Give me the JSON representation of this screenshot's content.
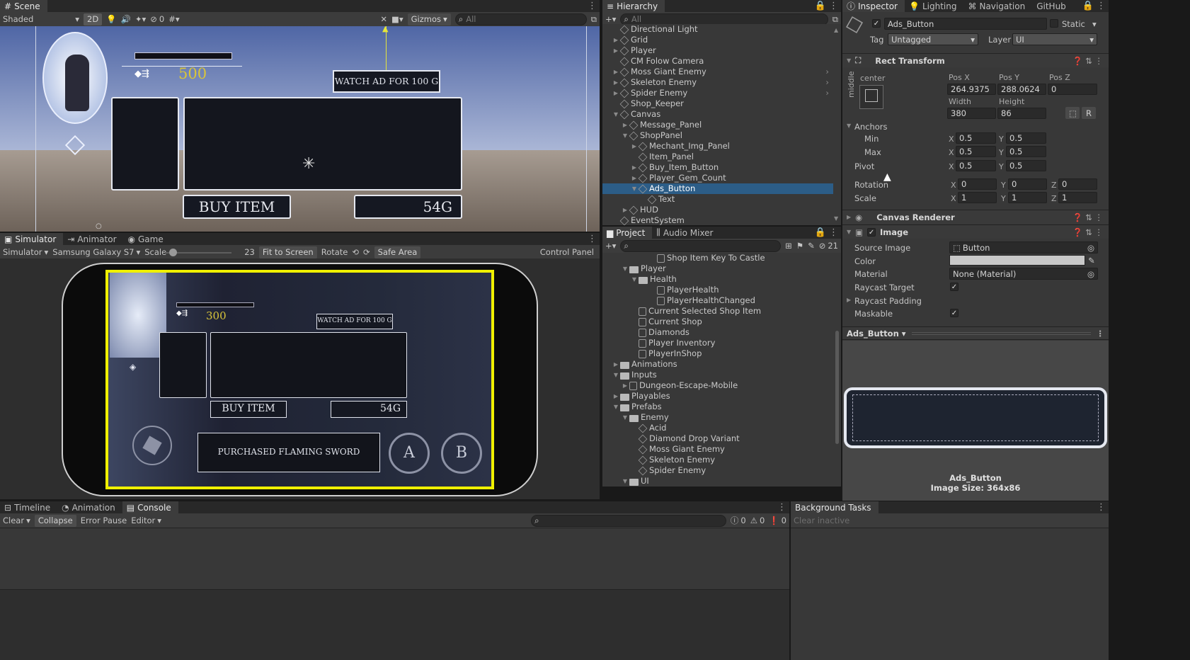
{
  "scene": {
    "tab": "Scene",
    "shading": "Shaded",
    "mode_2d": "2D",
    "gizmo_count": "0",
    "gizmos": "Gizmos",
    "search_placeholder": "All",
    "gem_count": "500",
    "watch_ad": "WATCH AD FOR 100 G",
    "buy_item": "BUY ITEM",
    "price": "54G"
  },
  "simulator": {
    "tabs": [
      "Simulator",
      "Animator",
      "Game"
    ],
    "view": "Simulator",
    "device": "Samsung Galaxy S7",
    "scale_label": "Scale",
    "scale_value": "23",
    "scale_fraction": 0.12,
    "fit": "Fit to Screen",
    "rotate": "Rotate",
    "safe_area": "Safe Area",
    "control_panel": "Control Panel",
    "game": {
      "gem_count": "300",
      "watch_ad": "WATCH AD FOR 100 G",
      "buy_item": "BUY ITEM",
      "price": "54G",
      "message": "PURCHASED FLAMING SWORD",
      "btn_a": "A",
      "btn_b": "B"
    }
  },
  "hierarchy": {
    "tab": "Hierarchy",
    "search_placeholder": "All",
    "items": [
      {
        "label": "Directional Light",
        "depth": 1,
        "arrow": "",
        "more": false
      },
      {
        "label": "Grid",
        "depth": 1,
        "arrow": "▶",
        "more": false
      },
      {
        "label": "Player",
        "depth": 1,
        "arrow": "▶",
        "more": false
      },
      {
        "label": "CM Folow Camera",
        "depth": 1,
        "arrow": "",
        "more": false
      },
      {
        "label": "Moss Giant Enemy",
        "depth": 1,
        "arrow": "▶",
        "more": true
      },
      {
        "label": "Skeleton Enemy",
        "depth": 1,
        "arrow": "▶",
        "more": true
      },
      {
        "label": "Spider Enemy",
        "depth": 1,
        "arrow": "▶",
        "more": true
      },
      {
        "label": "Shop_Keeper",
        "depth": 1,
        "arrow": "",
        "more": false
      },
      {
        "label": "Canvas",
        "depth": 1,
        "arrow": "▼",
        "more": false
      },
      {
        "label": "Message_Panel",
        "depth": 2,
        "arrow": "▶",
        "more": false
      },
      {
        "label": "ShopPanel",
        "depth": 2,
        "arrow": "▼",
        "more": false
      },
      {
        "label": "Mechant_Img_Panel",
        "depth": 3,
        "arrow": "▶",
        "more": false
      },
      {
        "label": "Item_Panel",
        "depth": 3,
        "arrow": "",
        "more": false
      },
      {
        "label": "Buy_Item_Button",
        "depth": 3,
        "arrow": "▶",
        "more": false
      },
      {
        "label": "Player_Gem_Count",
        "depth": 3,
        "arrow": "▶",
        "more": false
      },
      {
        "label": "Ads_Button",
        "depth": 3,
        "arrow": "▼",
        "more": false,
        "selected": true
      },
      {
        "label": "Text",
        "depth": 4,
        "arrow": "",
        "more": false
      },
      {
        "label": "HUD",
        "depth": 2,
        "arrow": "▶",
        "more": false
      },
      {
        "label": "EventSystem",
        "depth": 1,
        "arrow": "",
        "more": false
      }
    ]
  },
  "project": {
    "tabs": [
      "Project",
      "Audio Mixer"
    ],
    "hidden_count": "21",
    "items": [
      {
        "label": "Shop Item Key To Castle",
        "depth": 5,
        "icon": "file",
        "arrow": ""
      },
      {
        "label": "Player",
        "depth": 2,
        "icon": "folder",
        "arrow": "▼"
      },
      {
        "label": "Health",
        "depth": 3,
        "icon": "folder",
        "arrow": "▼"
      },
      {
        "label": "PlayerHealth",
        "depth": 5,
        "icon": "file",
        "arrow": ""
      },
      {
        "label": "PlayerHealthChanged",
        "depth": 5,
        "icon": "file",
        "arrow": ""
      },
      {
        "label": "Current Selected Shop Item",
        "depth": 3,
        "icon": "file",
        "arrow": ""
      },
      {
        "label": "Current Shop",
        "depth": 3,
        "icon": "file",
        "arrow": ""
      },
      {
        "label": "Diamonds",
        "depth": 3,
        "icon": "file",
        "arrow": ""
      },
      {
        "label": "Player Inventory",
        "depth": 3,
        "icon": "file",
        "arrow": ""
      },
      {
        "label": "PlayerInShop",
        "depth": 3,
        "icon": "file",
        "arrow": ""
      },
      {
        "label": "Animations",
        "depth": 1,
        "icon": "folder",
        "arrow": "▶"
      },
      {
        "label": "Inputs",
        "depth": 1,
        "icon": "folder",
        "arrow": "▼"
      },
      {
        "label": "Dungeon-Escape-Mobile",
        "depth": 2,
        "icon": "book",
        "arrow": "▶"
      },
      {
        "label": "Playables",
        "depth": 1,
        "icon": "folder",
        "arrow": "▶"
      },
      {
        "label": "Prefabs",
        "depth": 1,
        "icon": "folder",
        "arrow": "▼"
      },
      {
        "label": "Enemy",
        "depth": 2,
        "icon": "folder",
        "arrow": "▼"
      },
      {
        "label": "Acid",
        "depth": 3,
        "icon": "cube",
        "arrow": ""
      },
      {
        "label": "Diamond Drop Variant",
        "depth": 3,
        "icon": "cube",
        "arrow": ""
      },
      {
        "label": "Moss Giant Enemy",
        "depth": 3,
        "icon": "cube",
        "arrow": ""
      },
      {
        "label": "Skeleton Enemy",
        "depth": 3,
        "icon": "cube",
        "arrow": ""
      },
      {
        "label": "Spider Enemy",
        "depth": 3,
        "icon": "cube",
        "arrow": ""
      },
      {
        "label": "UI",
        "depth": 2,
        "icon": "folder",
        "arrow": "▼"
      }
    ]
  },
  "inspector": {
    "tabs": [
      "Inspector",
      "Lighting",
      "Navigation",
      "GitHub"
    ],
    "object_name": "Ads_Button",
    "static": "Static",
    "tag_label": "Tag",
    "tag": "Untagged",
    "layer_label": "Layer",
    "layer": "UI",
    "rect_transform": "Rect Transform",
    "anchor_h": "center",
    "anchor_v": "middle",
    "pos_x_label": "Pos X",
    "pos_x": "264.9375",
    "pos_y_label": "Pos Y",
    "pos_y": "288.0624",
    "pos_z_label": "Pos Z",
    "pos_z": "0",
    "width_label": "Width",
    "width": "380",
    "height_label": "Height",
    "height": "86",
    "r_button": "R",
    "anchors_label": "Anchors",
    "min_label": "Min",
    "min_x": "0.5",
    "min_y": "0.5",
    "max_label": "Max",
    "max_x": "0.5",
    "max_y": "0.5",
    "pivot_label": "Pivot",
    "pivot_x": "0.5",
    "pivot_y": "0.5",
    "rotation_label": "Rotation",
    "rot_x": "0",
    "rot_y": "0",
    "rot_z": "0",
    "scale_label": "Scale",
    "scale_x": "1",
    "scale_y": "1",
    "scale_z": "1",
    "x": "X",
    "y": "Y",
    "z": "Z",
    "canvas_renderer": "Canvas Renderer",
    "image": "Image",
    "source_image_label": "Source Image",
    "source_image": "Button",
    "color_label": "Color",
    "material_label": "Material",
    "material": "None (Material)",
    "raycast_target_label": "Raycast Target",
    "raycast_padding_label": "Raycast Padding",
    "maskable_label": "Maskable",
    "preview_dropdown": "Ads_Button",
    "preview_name": "Ads_Button",
    "preview_size": "Image Size: 364x86"
  },
  "console": {
    "tabs": [
      "Timeline",
      "Animation",
      "Console"
    ],
    "clear": "Clear",
    "collapse": "Collapse",
    "error_pause": "Error Pause",
    "editor": "Editor",
    "count_log": "0",
    "count_warn": "0",
    "count_err": "0"
  },
  "background_tasks": {
    "tab": "Background Tasks",
    "clear_inactive": "Clear inactive"
  },
  "colors": {
    "selection": "#2c5d87",
    "highlight_yellow": "#f0f000",
    "gem_gold": "#d9c53a"
  }
}
